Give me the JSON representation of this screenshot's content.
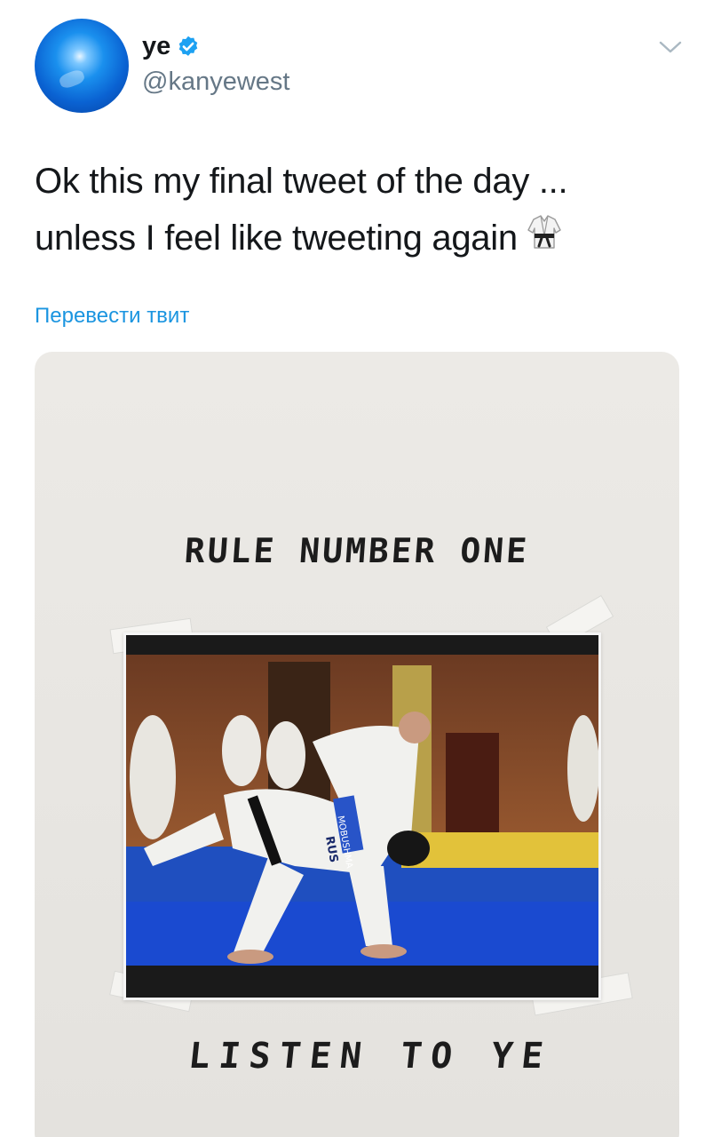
{
  "user": {
    "display_name": "ye",
    "handle": "@kanyewest",
    "verified_icon": "verified-badge-icon",
    "avatar": "blue-globe-avatar"
  },
  "tweet": {
    "text_line_1": "Ok this my final tweet of the day ...",
    "text_line_2": "unless I feel like tweeting again",
    "emoji": "martial-arts-uniform-emoji",
    "translate_label": "Перевести твит"
  },
  "media": {
    "handwritten_top": "RULE NUMBER ONE",
    "handwritten_bottom": "LISTEN TO YE",
    "photo_jersey_text": "MOBUSHMA",
    "photo_back_text": "RUS"
  },
  "colors": {
    "text": "#14171a",
    "secondary": "#657786",
    "link": "#1b95e0",
    "verified": "#1da1f2"
  }
}
